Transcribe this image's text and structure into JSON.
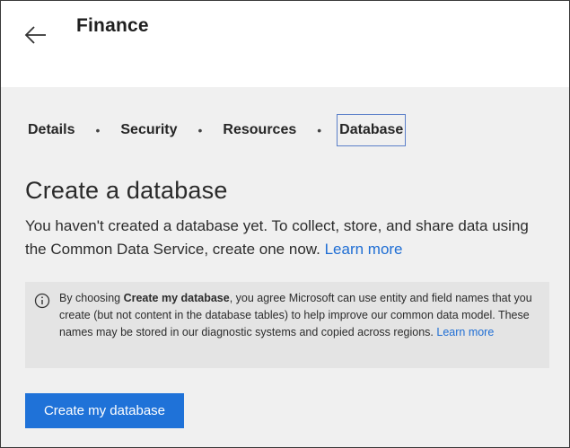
{
  "header": {
    "title": "Finance",
    "back_icon": "arrow-left-icon"
  },
  "tabs": [
    {
      "label": "Details",
      "active": false
    },
    {
      "label": "Security",
      "active": false
    },
    {
      "label": "Resources",
      "active": false
    },
    {
      "label": "Database",
      "active": true
    }
  ],
  "tab_separator": "•",
  "main": {
    "title": "Create a database",
    "description": "You haven't created a database yet. To collect, store, and share data using the Common Data Service, create one now.",
    "learn_more": "Learn more"
  },
  "notice": {
    "icon": "info-icon",
    "text_prefix": "By choosing ",
    "text_bold": "Create my database",
    "text_rest": ", you agree Microsoft can use entity and field names that you create (but not content in the database tables) to help improve our common data model. These names may be stored in our diagnostic systems and copied across regions.",
    "learn_more": "Learn more"
  },
  "actions": {
    "create_button": "Create my database"
  },
  "colors": {
    "accent": "#1f72d8",
    "link": "#1f6ed4",
    "content_bg": "#f0f0f0",
    "notice_bg": "#e4e4e4",
    "active_tab_border": "#5b7fc9"
  }
}
